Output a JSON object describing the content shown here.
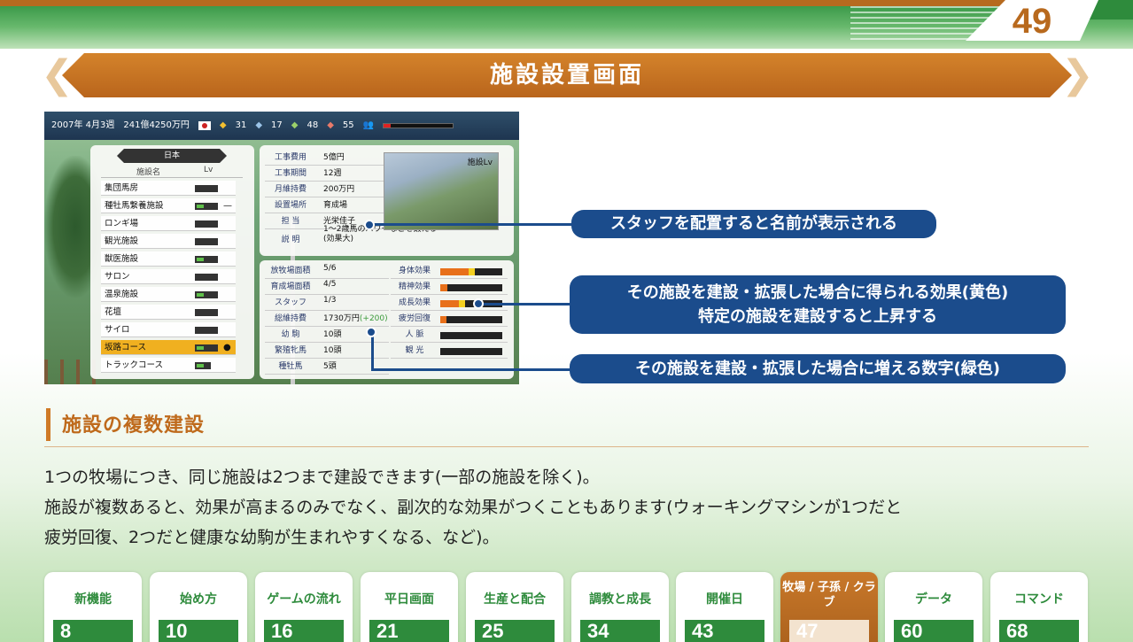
{
  "page_number": "49",
  "banner_title": "施設設置画面",
  "game": {
    "status": {
      "date": "2007年 4月3週",
      "money": "241億4250万円",
      "c1": "31",
      "c2": "17",
      "c3": "48",
      "c4": "55"
    },
    "list": {
      "header": "日本",
      "col_name": "施設名",
      "col_lv": "Lv",
      "items": [
        {
          "name": "集団馬房"
        },
        {
          "name": "種牡馬繋養施設"
        },
        {
          "name": "ロンギ場"
        },
        {
          "name": "観光施設"
        },
        {
          "name": "獣医施設"
        },
        {
          "name": "サロン"
        },
        {
          "name": "温泉施設"
        },
        {
          "name": "花壇"
        },
        {
          "name": "サイロ"
        },
        {
          "name": "坂路コース"
        },
        {
          "name": "トラックコース"
        }
      ],
      "dash": "—"
    },
    "info": {
      "rows": [
        {
          "k": "工事費用",
          "v": "5億円"
        },
        {
          "k": "工事期間",
          "v": "12週"
        },
        {
          "k": "月維持費",
          "v": "200万円"
        },
        {
          "k": "設置場所",
          "v": "育成場"
        },
        {
          "k": "担 当",
          "v": "光栄佳子"
        }
      ],
      "desc_key": "説 明",
      "desc_line1": "1～2歳馬のパワーなどを鍛える",
      "desc_line2": "(効果大)",
      "preview_label": "施設Lv"
    },
    "stats": {
      "rows": [
        {
          "k": "放牧場面積",
          "v": "5/6"
        },
        {
          "k": "育成場面積",
          "v": "4/5"
        },
        {
          "k": "スタッフ",
          "v": "1/3"
        },
        {
          "k": "総維持費",
          "v": "1730万円",
          "g": "(+200)"
        },
        {
          "k": "幼 駒",
          "v": "10頭"
        },
        {
          "k": "繁殖牝馬",
          "v": "10頭"
        },
        {
          "k": "種牡馬",
          "v": "5頭"
        }
      ],
      "effects": [
        {
          "k": "身体効果",
          "orange": 0.45,
          "yellow": 0.1
        },
        {
          "k": "精神効果",
          "orange": 0.12,
          "yellow": 0
        },
        {
          "k": "成長効果",
          "orange": 0.3,
          "yellow": 0.1
        },
        {
          "k": "疲労回復",
          "orange": 0.1,
          "yellow": 0
        },
        {
          "k": "人 脈",
          "orange": 0,
          "yellow": 0
        },
        {
          "k": "観 光",
          "orange": 0,
          "yellow": 0
        }
      ]
    }
  },
  "callouts": {
    "c1": "スタッフを配置すると名前が表示される",
    "c2_line1": "その施設を建設・拡張した場合に得られる効果(黄色)",
    "c2_line2": "特定の施設を建設すると上昇する",
    "c3": "その施設を建設・拡張した場合に増える数字(緑色)"
  },
  "section": {
    "title": "施設の複数建設",
    "line1": "1つの牧場につき、同じ施設は2つまで建設できます(一部の施設を除く)。",
    "line2": "施設が複数あると、効果が高まるのみでなく、副次的な効果がつくこともあります(ウォーキングマシンが1つだと",
    "line3": "疲労回復、2つだと健康な幼駒が生まれやすくなる、など)。"
  },
  "tabs": [
    {
      "label": "新機能",
      "num": "8"
    },
    {
      "label": "始め方",
      "num": "10"
    },
    {
      "label": "ゲームの流れ",
      "num": "16"
    },
    {
      "label": "平日画面",
      "num": "21"
    },
    {
      "label": "生産と配合",
      "num": "25"
    },
    {
      "label": "調教と成長",
      "num": "34"
    },
    {
      "label": "開催日",
      "num": "43"
    },
    {
      "label": "牧場 / 子孫 / クラブ",
      "num": "47",
      "active": true
    },
    {
      "label": "データ",
      "num": "60"
    },
    {
      "label": "コマンド",
      "num": "68"
    }
  ]
}
